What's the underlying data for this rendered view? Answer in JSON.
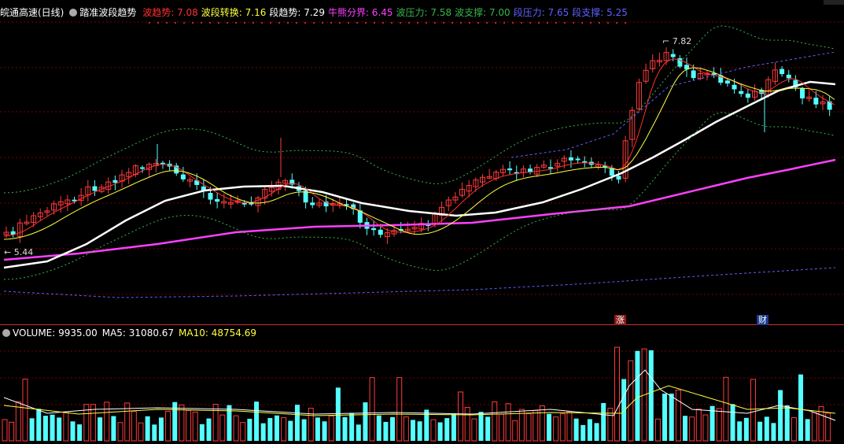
{
  "header": {
    "stock_name": "皖通高速(日线)",
    "indicator_name": "踏准波段趋势",
    "items": [
      {
        "label": "波趋势:",
        "value": "7.08",
        "color": "#ff3030"
      },
      {
        "label": "波段转换:",
        "value": "7.16",
        "color": "#ffff40"
      },
      {
        "label": "段趋势:",
        "value": "7.29",
        "color": "#ffffff"
      },
      {
        "label": "牛熊分界:",
        "value": "6.45",
        "color": "#ff40ff"
      },
      {
        "label": "波压力:",
        "value": "7.58",
        "color": "#39b54a"
      },
      {
        "label": "波支撑:",
        "value": "7.00",
        "color": "#39b54a"
      },
      {
        "label": "段压力:",
        "value": "7.65",
        "color": "#6060ff"
      },
      {
        "label": "段支撑:",
        "value": "5.25",
        "color": "#6060ff"
      }
    ]
  },
  "price_labels": {
    "high": "7.82",
    "low": "5.44"
  },
  "volume_header": {
    "items": [
      {
        "label": "VOLUME:",
        "value": "9935.00",
        "color": "#ffffff"
      },
      {
        "label": "MA5:",
        "value": "31080.67",
        "color": "#ffffff"
      },
      {
        "label": "MA10:",
        "value": "48754.69",
        "color": "#ffff40"
      }
    ]
  },
  "markers": {
    "zhang": "涨",
    "cai": "财"
  },
  "colors": {
    "up": "#ff3b3b",
    "down": "#54ffff",
    "grid": "#7a0000",
    "bull_bear": "#ff40ff",
    "segment_trend": "#ffffff",
    "wave_trend": "#ff3030",
    "wave_switch": "#ffff40"
  }
}
